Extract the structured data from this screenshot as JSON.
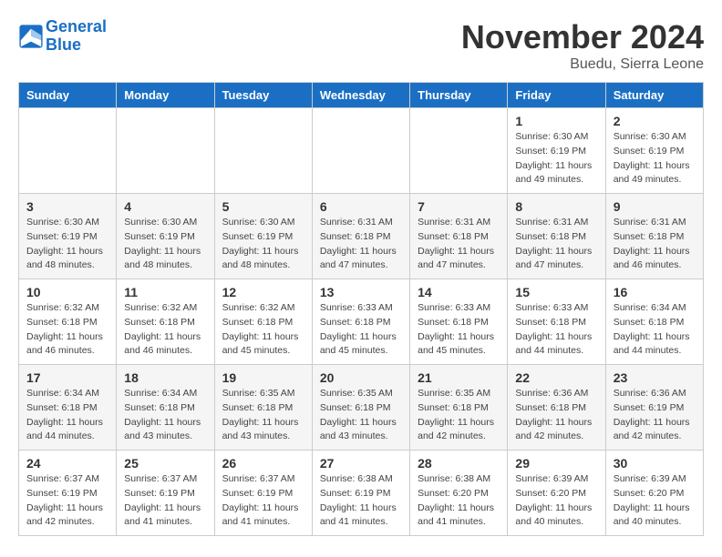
{
  "logo": {
    "line1": "General",
    "line2": "Blue"
  },
  "title": "November 2024",
  "location": "Buedu, Sierra Leone",
  "days_of_week": [
    "Sunday",
    "Monday",
    "Tuesday",
    "Wednesday",
    "Thursday",
    "Friday",
    "Saturday"
  ],
  "weeks": [
    [
      {
        "day": "",
        "info": ""
      },
      {
        "day": "",
        "info": ""
      },
      {
        "day": "",
        "info": ""
      },
      {
        "day": "",
        "info": ""
      },
      {
        "day": "",
        "info": ""
      },
      {
        "day": "1",
        "info": "Sunrise: 6:30 AM\nSunset: 6:19 PM\nDaylight: 11 hours\nand 49 minutes."
      },
      {
        "day": "2",
        "info": "Sunrise: 6:30 AM\nSunset: 6:19 PM\nDaylight: 11 hours\nand 49 minutes."
      }
    ],
    [
      {
        "day": "3",
        "info": "Sunrise: 6:30 AM\nSunset: 6:19 PM\nDaylight: 11 hours\nand 48 minutes."
      },
      {
        "day": "4",
        "info": "Sunrise: 6:30 AM\nSunset: 6:19 PM\nDaylight: 11 hours\nand 48 minutes."
      },
      {
        "day": "5",
        "info": "Sunrise: 6:30 AM\nSunset: 6:19 PM\nDaylight: 11 hours\nand 48 minutes."
      },
      {
        "day": "6",
        "info": "Sunrise: 6:31 AM\nSunset: 6:18 PM\nDaylight: 11 hours\nand 47 minutes."
      },
      {
        "day": "7",
        "info": "Sunrise: 6:31 AM\nSunset: 6:18 PM\nDaylight: 11 hours\nand 47 minutes."
      },
      {
        "day": "8",
        "info": "Sunrise: 6:31 AM\nSunset: 6:18 PM\nDaylight: 11 hours\nand 47 minutes."
      },
      {
        "day": "9",
        "info": "Sunrise: 6:31 AM\nSunset: 6:18 PM\nDaylight: 11 hours\nand 46 minutes."
      }
    ],
    [
      {
        "day": "10",
        "info": "Sunrise: 6:32 AM\nSunset: 6:18 PM\nDaylight: 11 hours\nand 46 minutes."
      },
      {
        "day": "11",
        "info": "Sunrise: 6:32 AM\nSunset: 6:18 PM\nDaylight: 11 hours\nand 46 minutes."
      },
      {
        "day": "12",
        "info": "Sunrise: 6:32 AM\nSunset: 6:18 PM\nDaylight: 11 hours\nand 45 minutes."
      },
      {
        "day": "13",
        "info": "Sunrise: 6:33 AM\nSunset: 6:18 PM\nDaylight: 11 hours\nand 45 minutes."
      },
      {
        "day": "14",
        "info": "Sunrise: 6:33 AM\nSunset: 6:18 PM\nDaylight: 11 hours\nand 45 minutes."
      },
      {
        "day": "15",
        "info": "Sunrise: 6:33 AM\nSunset: 6:18 PM\nDaylight: 11 hours\nand 44 minutes."
      },
      {
        "day": "16",
        "info": "Sunrise: 6:34 AM\nSunset: 6:18 PM\nDaylight: 11 hours\nand 44 minutes."
      }
    ],
    [
      {
        "day": "17",
        "info": "Sunrise: 6:34 AM\nSunset: 6:18 PM\nDaylight: 11 hours\nand 44 minutes."
      },
      {
        "day": "18",
        "info": "Sunrise: 6:34 AM\nSunset: 6:18 PM\nDaylight: 11 hours\nand 43 minutes."
      },
      {
        "day": "19",
        "info": "Sunrise: 6:35 AM\nSunset: 6:18 PM\nDaylight: 11 hours\nand 43 minutes."
      },
      {
        "day": "20",
        "info": "Sunrise: 6:35 AM\nSunset: 6:18 PM\nDaylight: 11 hours\nand 43 minutes."
      },
      {
        "day": "21",
        "info": "Sunrise: 6:35 AM\nSunset: 6:18 PM\nDaylight: 11 hours\nand 42 minutes."
      },
      {
        "day": "22",
        "info": "Sunrise: 6:36 AM\nSunset: 6:18 PM\nDaylight: 11 hours\nand 42 minutes."
      },
      {
        "day": "23",
        "info": "Sunrise: 6:36 AM\nSunset: 6:19 PM\nDaylight: 11 hours\nand 42 minutes."
      }
    ],
    [
      {
        "day": "24",
        "info": "Sunrise: 6:37 AM\nSunset: 6:19 PM\nDaylight: 11 hours\nand 42 minutes."
      },
      {
        "day": "25",
        "info": "Sunrise: 6:37 AM\nSunset: 6:19 PM\nDaylight: 11 hours\nand 41 minutes."
      },
      {
        "day": "26",
        "info": "Sunrise: 6:37 AM\nSunset: 6:19 PM\nDaylight: 11 hours\nand 41 minutes."
      },
      {
        "day": "27",
        "info": "Sunrise: 6:38 AM\nSunset: 6:19 PM\nDaylight: 11 hours\nand 41 minutes."
      },
      {
        "day": "28",
        "info": "Sunrise: 6:38 AM\nSunset: 6:20 PM\nDaylight: 11 hours\nand 41 minutes."
      },
      {
        "day": "29",
        "info": "Sunrise: 6:39 AM\nSunset: 6:20 PM\nDaylight: 11 hours\nand 40 minutes."
      },
      {
        "day": "30",
        "info": "Sunrise: 6:39 AM\nSunset: 6:20 PM\nDaylight: 11 hours\nand 40 minutes."
      }
    ]
  ]
}
